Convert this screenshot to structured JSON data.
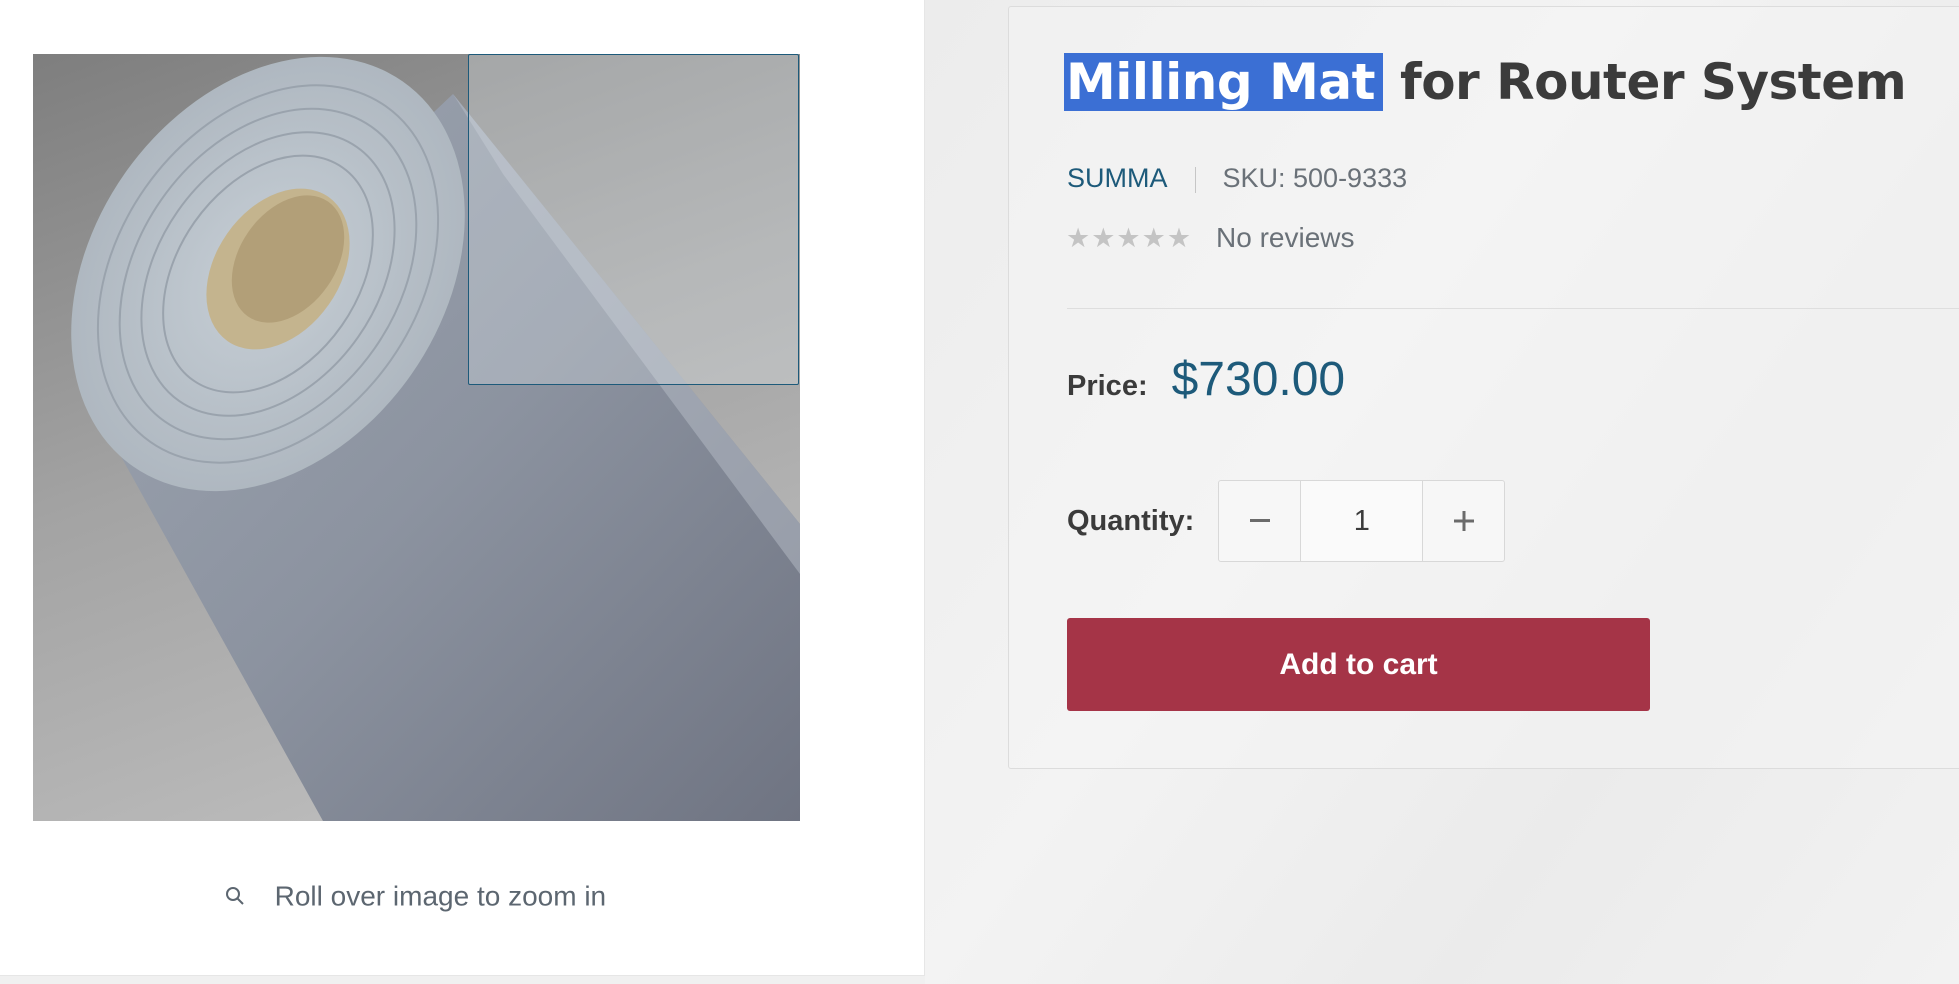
{
  "product": {
    "title_selected": "Milling Mat",
    "title_rest": "for Router System",
    "vendor": "SUMMA",
    "sku": "SKU: 500-9333",
    "rating_stars": 0,
    "reviews_text": "No reviews",
    "price_label": "Price:",
    "price": "$730.00",
    "quantity_label": "Quantity:",
    "quantity": "1",
    "add_to_cart_label": "Add to cart"
  },
  "gallery": {
    "zoom_hint": "Roll over image to zoom in",
    "hint_icon": "search-icon"
  },
  "colors": {
    "accent": "#1d5a7a",
    "cart_button": "#a53447",
    "selection": "#3b6fd4"
  }
}
